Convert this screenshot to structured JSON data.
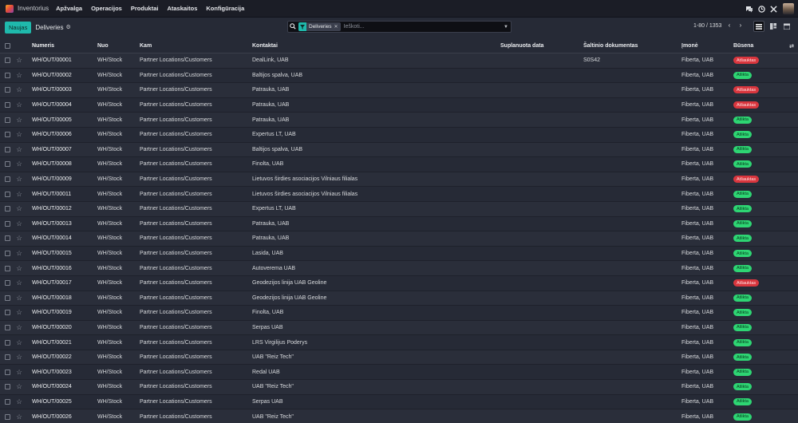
{
  "navbar": {
    "app_name": "Inventorius",
    "menu": [
      "Apžvalga",
      "Operacijos",
      "Produktai",
      "Ataskaitos",
      "Konfigūracija"
    ],
    "icons": [
      "chat-icon",
      "clock-icon",
      "tools-icon",
      "avatar"
    ]
  },
  "control": {
    "new_label": "Naujas",
    "breadcrumb": "Deliveries",
    "search": {
      "facet_label": "Deliveries",
      "placeholder": "Ieškoti..."
    },
    "pager": "1-80 / 1353"
  },
  "colors": {
    "accent": "#1fb9ac",
    "done": "#2ed573",
    "cancel": "#d9363e"
  },
  "table": {
    "columns": {
      "number": "Numeris",
      "from": "Nuo",
      "to": "Kam",
      "contact": "Kontaktai",
      "scheduled": "Suplanuota data",
      "source": "Šaltinio dokumentas",
      "company": "Įmonė",
      "status": "Būsena"
    },
    "rows": [
      {
        "number": "WH/OUT/00001",
        "from": "WH/Stock",
        "to": "Partner Locations/Customers",
        "contact": "DealLink, UAB",
        "scheduled": "",
        "source": "S0S42",
        "company": "Fiberta, UAB",
        "status": "Atšauktas",
        "state": "cancel"
      },
      {
        "number": "WH/OUT/00002",
        "from": "WH/Stock",
        "to": "Partner Locations/Customers",
        "contact": "Baltijos spalva, UAB",
        "scheduled": "",
        "source": "",
        "company": "Fiberta, UAB",
        "status": "Atlikta",
        "state": "done"
      },
      {
        "number": "WH/OUT/00003",
        "from": "WH/Stock",
        "to": "Partner Locations/Customers",
        "contact": "Patrauka, UAB",
        "scheduled": "",
        "source": "",
        "company": "Fiberta, UAB",
        "status": "Atšauktas",
        "state": "cancel"
      },
      {
        "number": "WH/OUT/00004",
        "from": "WH/Stock",
        "to": "Partner Locations/Customers",
        "contact": "Patrauka, UAB",
        "scheduled": "",
        "source": "",
        "company": "Fiberta, UAB",
        "status": "Atšauktas",
        "state": "cancel"
      },
      {
        "number": "WH/OUT/00005",
        "from": "WH/Stock",
        "to": "Partner Locations/Customers",
        "contact": "Patrauka, UAB",
        "scheduled": "",
        "source": "",
        "company": "Fiberta, UAB",
        "status": "Atlikta",
        "state": "done"
      },
      {
        "number": "WH/OUT/00006",
        "from": "WH/Stock",
        "to": "Partner Locations/Customers",
        "contact": "Expertus LT, UAB",
        "scheduled": "",
        "source": "",
        "company": "Fiberta, UAB",
        "status": "Atlikta",
        "state": "done"
      },
      {
        "number": "WH/OUT/00007",
        "from": "WH/Stock",
        "to": "Partner Locations/Customers",
        "contact": "Baltijos spalva, UAB",
        "scheduled": "",
        "source": "",
        "company": "Fiberta, UAB",
        "status": "Atlikta",
        "state": "done"
      },
      {
        "number": "WH/OUT/00008",
        "from": "WH/Stock",
        "to": "Partner Locations/Customers",
        "contact": "Finolta, UAB",
        "scheduled": "",
        "source": "",
        "company": "Fiberta, UAB",
        "status": "Atlikta",
        "state": "done"
      },
      {
        "number": "WH/OUT/00009",
        "from": "WH/Stock",
        "to": "Partner Locations/Customers",
        "contact": "Lietuvos širdies asociacijos Vilniaus filialas",
        "scheduled": "",
        "source": "",
        "company": "Fiberta, UAB",
        "status": "Atšauktas",
        "state": "cancel"
      },
      {
        "number": "WH/OUT/00011",
        "from": "WH/Stock",
        "to": "Partner Locations/Customers",
        "contact": "Lietuvos širdies asociacijos Vilniaus filialas",
        "scheduled": "",
        "source": "",
        "company": "Fiberta, UAB",
        "status": "Atlikta",
        "state": "done"
      },
      {
        "number": "WH/OUT/00012",
        "from": "WH/Stock",
        "to": "Partner Locations/Customers",
        "contact": "Expertus LT, UAB",
        "scheduled": "",
        "source": "",
        "company": "Fiberta, UAB",
        "status": "Atlikta",
        "state": "done"
      },
      {
        "number": "WH/OUT/00013",
        "from": "WH/Stock",
        "to": "Partner Locations/Customers",
        "contact": "Patrauka, UAB",
        "scheduled": "",
        "source": "",
        "company": "Fiberta, UAB",
        "status": "Atlikta",
        "state": "done"
      },
      {
        "number": "WH/OUT/00014",
        "from": "WH/Stock",
        "to": "Partner Locations/Customers",
        "contact": "Patrauka, UAB",
        "scheduled": "",
        "source": "",
        "company": "Fiberta, UAB",
        "status": "Atlikta",
        "state": "done"
      },
      {
        "number": "WH/OUT/00015",
        "from": "WH/Stock",
        "to": "Partner Locations/Customers",
        "contact": "Lasida, UAB",
        "scheduled": "",
        "source": "",
        "company": "Fiberta, UAB",
        "status": "Atlikta",
        "state": "done"
      },
      {
        "number": "WH/OUT/00016",
        "from": "WH/Stock",
        "to": "Partner Locations/Customers",
        "contact": "Autoverema UAB",
        "scheduled": "",
        "source": "",
        "company": "Fiberta, UAB",
        "status": "Atlikta",
        "state": "done"
      },
      {
        "number": "WH/OUT/00017",
        "from": "WH/Stock",
        "to": "Partner Locations/Customers",
        "contact": "Geodezijos linija UAB Geoline",
        "scheduled": "",
        "source": "",
        "company": "Fiberta, UAB",
        "status": "Atšauktas",
        "state": "cancel"
      },
      {
        "number": "WH/OUT/00018",
        "from": "WH/Stock",
        "to": "Partner Locations/Customers",
        "contact": "Geodezijos linija UAB Geoline",
        "scheduled": "",
        "source": "",
        "company": "Fiberta, UAB",
        "status": "Atlikta",
        "state": "done"
      },
      {
        "number": "WH/OUT/00019",
        "from": "WH/Stock",
        "to": "Partner Locations/Customers",
        "contact": "Finolta, UAB",
        "scheduled": "",
        "source": "",
        "company": "Fiberta, UAB",
        "status": "Atlikta",
        "state": "done"
      },
      {
        "number": "WH/OUT/00020",
        "from": "WH/Stock",
        "to": "Partner Locations/Customers",
        "contact": "Serpas UAB",
        "scheduled": "",
        "source": "",
        "company": "Fiberta, UAB",
        "status": "Atlikta",
        "state": "done"
      },
      {
        "number": "WH/OUT/00021",
        "from": "WH/Stock",
        "to": "Partner Locations/Customers",
        "contact": "LRS Virgilijus Poderys",
        "scheduled": "",
        "source": "",
        "company": "Fiberta, UAB",
        "status": "Atlikta",
        "state": "done"
      },
      {
        "number": "WH/OUT/00022",
        "from": "WH/Stock",
        "to": "Partner Locations/Customers",
        "contact": "UAB \"Reiz Tech\"",
        "scheduled": "",
        "source": "",
        "company": "Fiberta, UAB",
        "status": "Atlikta",
        "state": "done"
      },
      {
        "number": "WH/OUT/00023",
        "from": "WH/Stock",
        "to": "Partner Locations/Customers",
        "contact": "Redal UAB",
        "scheduled": "",
        "source": "",
        "company": "Fiberta, UAB",
        "status": "Atlikta",
        "state": "done"
      },
      {
        "number": "WH/OUT/00024",
        "from": "WH/Stock",
        "to": "Partner Locations/Customers",
        "contact": "UAB \"Reiz Tech\"",
        "scheduled": "",
        "source": "",
        "company": "Fiberta, UAB",
        "status": "Atlikta",
        "state": "done"
      },
      {
        "number": "WH/OUT/00025",
        "from": "WH/Stock",
        "to": "Partner Locations/Customers",
        "contact": "Serpas UAB",
        "scheduled": "",
        "source": "",
        "company": "Fiberta, UAB",
        "status": "Atlikta",
        "state": "done"
      },
      {
        "number": "WH/OUT/00026",
        "from": "WH/Stock",
        "to": "Partner Locations/Customers",
        "contact": "UAB \"Reiz Tech\"",
        "scheduled": "",
        "source": "",
        "company": "Fiberta, UAB",
        "status": "Atlikta",
        "state": "done"
      }
    ]
  }
}
